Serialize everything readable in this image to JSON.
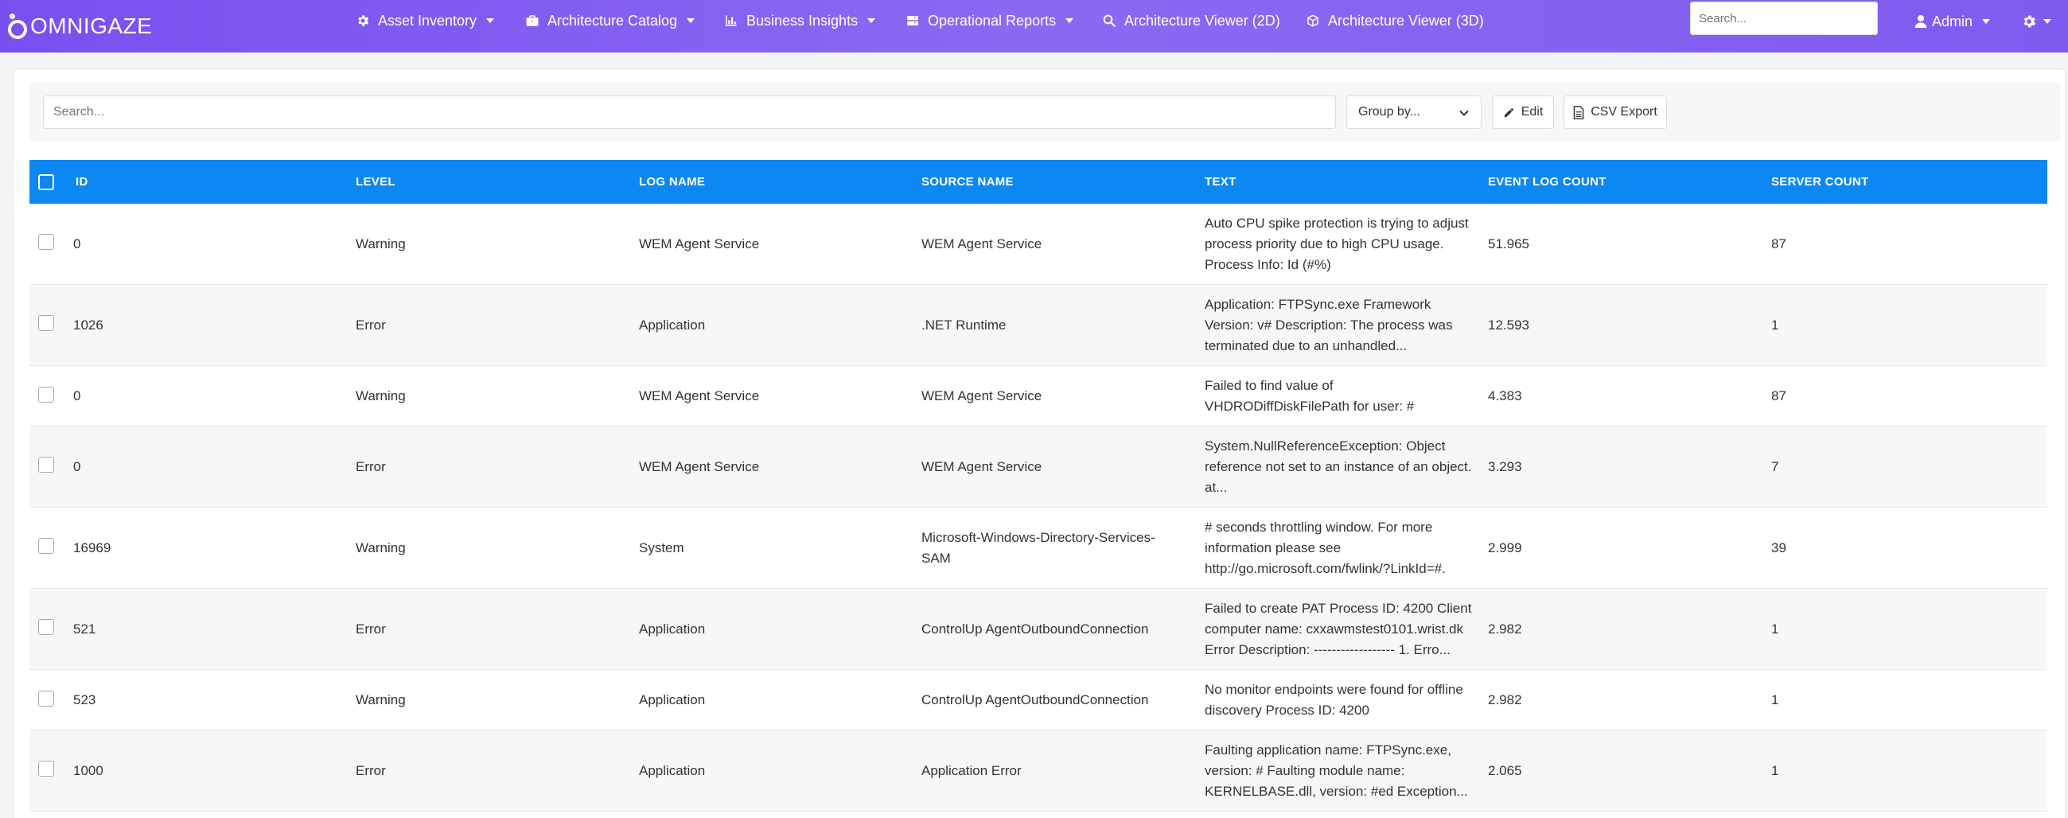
{
  "brand": {
    "name": "OMNIGAZE"
  },
  "nav": {
    "items": [
      {
        "label": "Asset Inventory",
        "icon": "gear-icon",
        "dropdown": true
      },
      {
        "label": "Architecture Catalog",
        "icon": "briefcase-icon",
        "dropdown": true
      },
      {
        "label": "Business Insights",
        "icon": "bar-chart-icon",
        "dropdown": true
      },
      {
        "label": "Operational Reports",
        "icon": "server-icon",
        "dropdown": true
      },
      {
        "label": "Architecture Viewer (2D)",
        "icon": "search-icon",
        "dropdown": false
      },
      {
        "label": "Architecture Viewer (3D)",
        "icon": "cube-icon",
        "dropdown": false
      }
    ],
    "search_placeholder": "Search...",
    "user": "Admin",
    "settings_icon": "gear-icon"
  },
  "toolbar": {
    "search_placeholder": "Search...",
    "group_by": "Group by...",
    "edit_label": "Edit",
    "csv_label": "CSV Export"
  },
  "table": {
    "columns": [
      "ID",
      "LEVEL",
      "LOG NAME",
      "SOURCE NAME",
      "TEXT",
      "EVENT LOG COUNT",
      "SERVER COUNT"
    ],
    "rows": [
      {
        "id": "0",
        "level": "Warning",
        "log_name": "WEM Agent Service",
        "source": "WEM Agent Service",
        "text": "Auto CPU spike protection is trying to adjust process priority due to high CPU usage. Process Info: Id (#%)",
        "event_count": "51.965",
        "server_count": "87"
      },
      {
        "id": "1026",
        "level": "Error",
        "log_name": "Application",
        "source": ".NET Runtime",
        "text": "Application: FTPSync.exe Framework Version: v# Description: The process was terminated due to an unhandled...",
        "event_count": "12.593",
        "server_count": "1"
      },
      {
        "id": "0",
        "level": "Warning",
        "log_name": "WEM Agent Service",
        "source": "WEM Agent Service",
        "text": "Failed to find value of VHDRODiffDiskFilePath for user: #",
        "event_count": "4.383",
        "server_count": "87"
      },
      {
        "id": "0",
        "level": "Error",
        "log_name": "WEM Agent Service",
        "source": "WEM Agent Service",
        "text": "System.NullReferenceException: Object reference not set to an instance of an object. at...",
        "event_count": "3.293",
        "server_count": "7"
      },
      {
        "id": "16969",
        "level": "Warning",
        "log_name": "System",
        "source": "Microsoft-Windows-Directory-Services-SAM",
        "text": "# seconds throttling window. For more information please see http://go.microsoft.com/fwlink/?LinkId=#.",
        "event_count": "2.999",
        "server_count": "39"
      },
      {
        "id": "521",
        "level": "Error",
        "log_name": "Application",
        "source": "ControlUp AgentOutboundConnection",
        "text": "Failed to create PAT Process ID: 4200 Client computer name: cxxawmstest0101.wrist.dk Error Description: ------------------ 1. Erro...",
        "event_count": "2.982",
        "server_count": "1"
      },
      {
        "id": "523",
        "level": "Warning",
        "log_name": "Application",
        "source": "ControlUp AgentOutboundConnection",
        "text": "No monitor endpoints were found for offline discovery Process ID: 4200",
        "event_count": "2.982",
        "server_count": "1"
      },
      {
        "id": "1000",
        "level": "Error",
        "log_name": "Application",
        "source": "Application Error",
        "text": "Faulting application name: FTPSync.exe, version: # Faulting module name: KERNELBASE.dll, version: #ed Exception...",
        "event_count": "2.065",
        "server_count": "1"
      }
    ]
  },
  "colors": {
    "nav_gradient_start": "#7a4ff0",
    "header_blue": "#0d88f3"
  }
}
